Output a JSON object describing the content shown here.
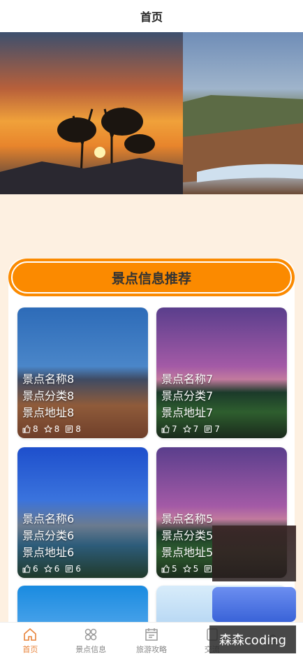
{
  "header": {
    "title": "首页"
  },
  "section": {
    "title": "景点信息推荐"
  },
  "cards": [
    {
      "name": "景点名称8",
      "category": "景点分类8",
      "address": "景点地址8",
      "likes": "8",
      "favorites": "8",
      "views": "8"
    },
    {
      "name": "景点名称7",
      "category": "景点分类7",
      "address": "景点地址7",
      "likes": "7",
      "favorites": "7",
      "views": "7"
    },
    {
      "name": "景点名称6",
      "category": "景点分类6",
      "address": "景点地址6",
      "likes": "6",
      "favorites": "6",
      "views": "6"
    },
    {
      "name": "景点名称5",
      "category": "景点分类5",
      "address": "景点地址5",
      "likes": "5",
      "favorites": "5",
      "views": ""
    }
  ],
  "tabs": [
    {
      "label": "首页",
      "icon": "home-icon"
    },
    {
      "label": "景点信息",
      "icon": "grid-icon"
    },
    {
      "label": "旅游攻略",
      "icon": "calendar-icon"
    },
    {
      "label": "交流",
      "icon": "chat-icon"
    },
    {
      "label": "",
      "icon": "user-icon"
    }
  ],
  "watermark": "森森coding",
  "colors": {
    "accent": "#fb8a00",
    "active_tab": "#e8833a",
    "background": "#fdf0e1"
  }
}
